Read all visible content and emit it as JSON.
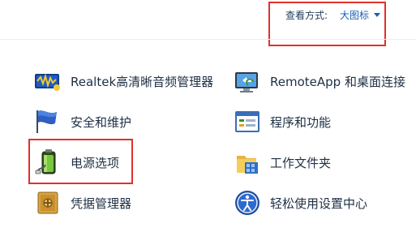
{
  "header": {
    "view_by_label": "查看方式:",
    "view_by_value": "大图标"
  },
  "items": [
    {
      "label": "Realtek高清晰音频管理器",
      "icon": "realtek-audio-icon"
    },
    {
      "label": "RemoteApp 和桌面连接",
      "icon": "remoteapp-icon"
    },
    {
      "label": "安全和维护",
      "icon": "security-maintenance-flag-icon"
    },
    {
      "label": "程序和功能",
      "icon": "programs-features-icon"
    },
    {
      "label": "电源选项",
      "icon": "power-options-battery-icon"
    },
    {
      "label": "工作文件夹",
      "icon": "work-folders-icon"
    },
    {
      "label": "凭据管理器",
      "icon": "credential-manager-safe-icon"
    },
    {
      "label": "轻松使用设置中心",
      "icon": "ease-of-access-icon"
    }
  ],
  "colors": {
    "highlight": "#e0312b",
    "link": "#1a5fb4",
    "text": "#1e2f44"
  }
}
